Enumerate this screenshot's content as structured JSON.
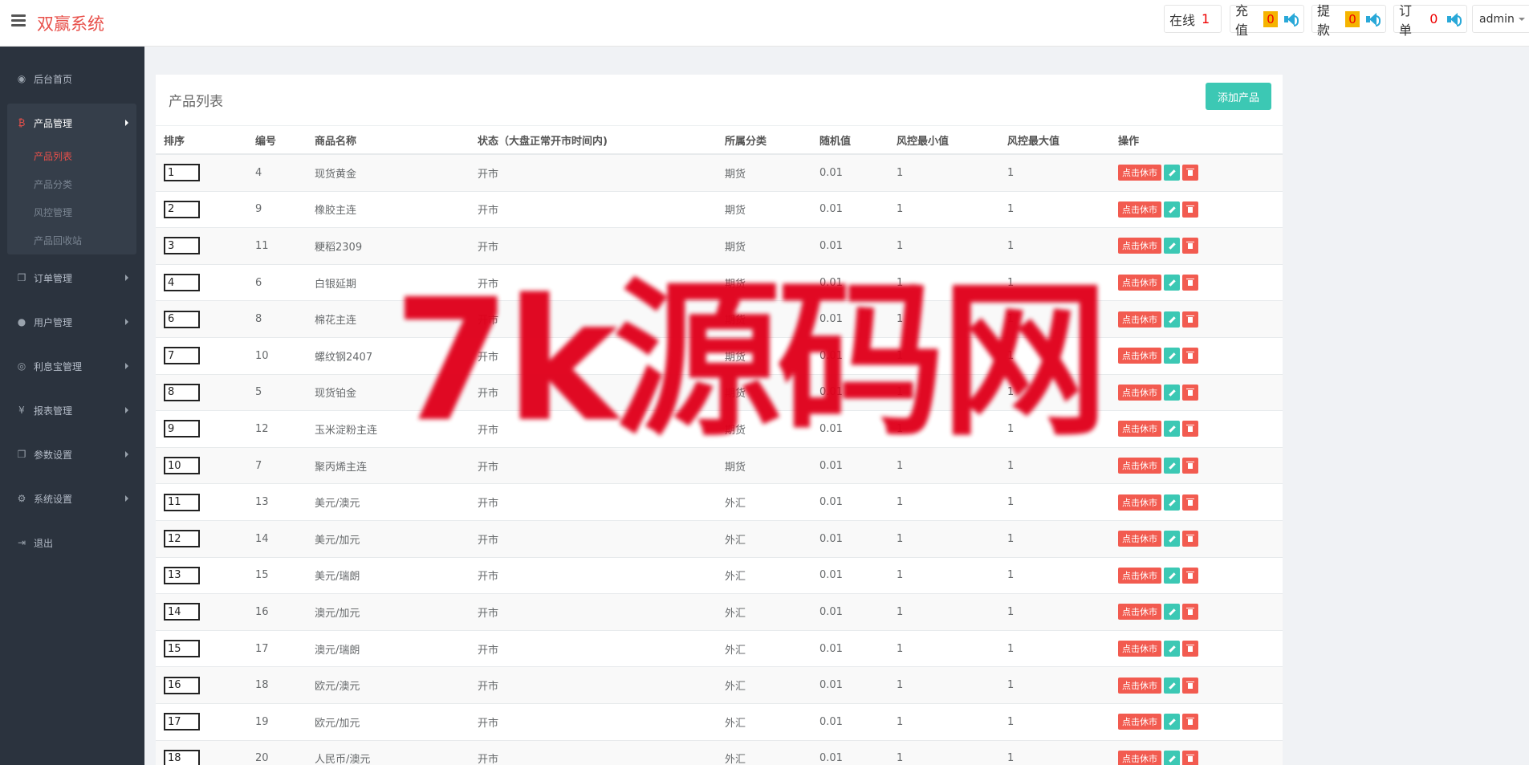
{
  "header": {
    "brand": "双赢系统",
    "online_label": "在线",
    "online_count": "1",
    "recharge_label": "充值",
    "recharge_count": "0",
    "withdraw_label": "提款",
    "withdraw_count": "0",
    "order_label": "订单",
    "order_count": "0",
    "user": "admin"
  },
  "sidebar": {
    "items": [
      {
        "label": "后台首页",
        "icon": "dashboard-icon"
      },
      {
        "label": "产品管理",
        "icon": "bitcoin-icon"
      },
      {
        "label": "订单管理",
        "icon": "copy-icon"
      },
      {
        "label": "用户管理",
        "icon": "user-icon"
      },
      {
        "label": "利息宝管理",
        "icon": "target-icon"
      },
      {
        "label": "报表管理",
        "icon": "yen-icon"
      },
      {
        "label": "参数设置",
        "icon": "copy-icon"
      },
      {
        "label": "系统设置",
        "icon": "gears-icon"
      },
      {
        "label": "退出",
        "icon": "logout-icon"
      }
    ],
    "subitems": [
      "产品列表",
      "产品分类",
      "风控管理",
      "产品回收站"
    ]
  },
  "main": {
    "title": "产品列表",
    "add_button": "添加产品",
    "columns": [
      "排序",
      "编号",
      "商品名称",
      "状态（大盘正常开市时间内)",
      "所属分类",
      "随机值",
      "风控最小值",
      "风控最大值",
      "操作"
    ],
    "rest_label": "点击休市",
    "rows": [
      [
        "1",
        "4",
        "现货黄金",
        "开市",
        "期货",
        "0.01",
        "1",
        "1"
      ],
      [
        "2",
        "9",
        "橡胶主连",
        "开市",
        "期货",
        "0.01",
        "1",
        "1"
      ],
      [
        "3",
        "11",
        "粳稻2309",
        "开市",
        "期货",
        "0.01",
        "1",
        "1"
      ],
      [
        "4",
        "6",
        "白银延期",
        "开市",
        "期货",
        "0.01",
        "1",
        "1"
      ],
      [
        "6",
        "8",
        "棉花主连",
        "开市",
        "期货",
        "0.01",
        "1",
        "1"
      ],
      [
        "7",
        "10",
        "螺纹钢2407",
        "开市",
        "期货",
        "0.01",
        "1",
        "1"
      ],
      [
        "8",
        "5",
        "现货铂金",
        "开市",
        "期货",
        "0.01",
        "1",
        "1"
      ],
      [
        "9",
        "12",
        "玉米淀粉主连",
        "开市",
        "期货",
        "0.01",
        "1",
        "1"
      ],
      [
        "10",
        "7",
        "聚丙烯主连",
        "开市",
        "期货",
        "0.01",
        "1",
        "1"
      ],
      [
        "11",
        "13",
        "美元/澳元",
        "开市",
        "外汇",
        "0.01",
        "1",
        "1"
      ],
      [
        "12",
        "14",
        "美元/加元",
        "开市",
        "外汇",
        "0.01",
        "1",
        "1"
      ],
      [
        "13",
        "15",
        "美元/瑞朗",
        "开市",
        "外汇",
        "0.01",
        "1",
        "1"
      ],
      [
        "14",
        "16",
        "澳元/加元",
        "开市",
        "外汇",
        "0.01",
        "1",
        "1"
      ],
      [
        "15",
        "17",
        "澳元/瑞朗",
        "开市",
        "外汇",
        "0.01",
        "1",
        "1"
      ],
      [
        "16",
        "18",
        "欧元/澳元",
        "开市",
        "外汇",
        "0.01",
        "1",
        "1"
      ],
      [
        "17",
        "19",
        "欧元/加元",
        "开市",
        "外汇",
        "0.01",
        "1",
        "1"
      ],
      [
        "18",
        "20",
        "人民币/澳元",
        "开市",
        "外汇",
        "0.01",
        "1",
        "1"
      ]
    ]
  },
  "watermark": "7k源码网"
}
